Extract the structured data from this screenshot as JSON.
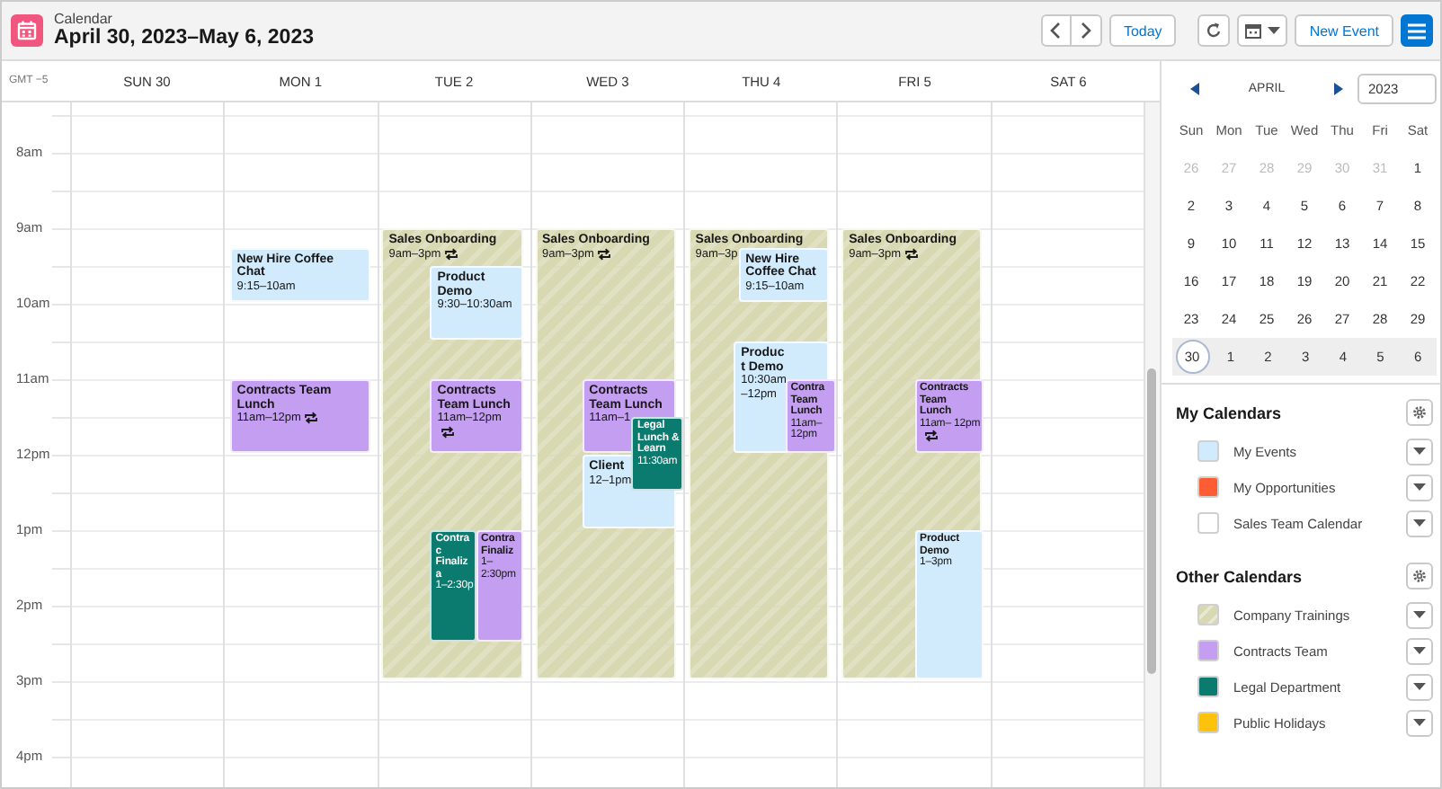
{
  "header": {
    "app_name": "Calendar",
    "title": "April 30, 2023–May 6, 2023",
    "buttons": {
      "today": "Today",
      "new_event": "New Event"
    },
    "list_view_selected": true
  },
  "week_view": {
    "timezone": "GMT −5",
    "hours": [
      "8am",
      "9am",
      "10am",
      "11am",
      "12pm",
      "1pm",
      "2pm",
      "3pm",
      "4pm"
    ],
    "days": [
      {
        "label": "SUN 30"
      },
      {
        "label": "MON 1",
        "events": [
          {
            "title": "New Hire Coffee Chat",
            "time": "9:15–10am",
            "color": "#d2ebfc",
            "kind": "solid",
            "recurring": false
          },
          {
            "title": "Contracts Team Lunch",
            "time": "11am–12pm",
            "color": "#c49ef0",
            "kind": "solid",
            "recurring": true
          }
        ]
      },
      {
        "label": "TUE 2",
        "events": [
          {
            "title": "Sales Onboarding",
            "time": "9am–3pm",
            "color": "#d8d9b3",
            "kind": "striped",
            "recurring": true
          },
          {
            "title": "Product Demo",
            "time": "9:30–10:30am",
            "color": "#d2ebfc",
            "kind": "solid",
            "recurring": false
          },
          {
            "title": "Contracts Team Lunch",
            "time": "11am–12pm",
            "color": "#c49ef0",
            "kind": "solid",
            "recurring": true
          },
          {
            "title": "Contrac Finaliza",
            "time": "1–2:30p",
            "color": "#0b7b70",
            "kind": "solid",
            "recurring": false
          },
          {
            "title": "Contra Finaliz",
            "time": "1– 2:30pm",
            "color": "#c49ef0",
            "kind": "solid",
            "recurring": false
          }
        ]
      },
      {
        "label": "WED 3",
        "events": [
          {
            "title": "Sales Onboarding",
            "time": "9am–3pm",
            "color": "#d8d9b3",
            "kind": "striped",
            "recurring": true
          },
          {
            "title": "Contracts Team Lunch",
            "time": "11am–1",
            "color": "#c49ef0",
            "kind": "solid",
            "recurring": false
          },
          {
            "title": "Client",
            "time": "12–1pm",
            "color": "#d2ebfc",
            "kind": "solid",
            "recurring": false
          },
          {
            "title": "Legal Lunch & Learn",
            "time": "11:30am",
            "color": "#0b7b70",
            "kind": "solid",
            "recurring": false
          }
        ]
      },
      {
        "label": "THU 4",
        "events": [
          {
            "title": "Sales Onboarding",
            "time": "9am–3p",
            "color": "#d8d9b3",
            "kind": "striped",
            "recurring": false
          },
          {
            "title": "New Hire Coffee Chat",
            "time": "9:15–10am",
            "color": "#d2ebfc",
            "kind": "solid",
            "recurring": false
          },
          {
            "title": "Product Demo",
            "time": "10:30am–12pm",
            "color": "#d2ebfc",
            "kind": "solid",
            "recurring": false
          },
          {
            "title": "Contra Team Lunch",
            "time": "11am– 12pm",
            "color": "#c49ef0",
            "kind": "solid",
            "recurring": false
          }
        ]
      },
      {
        "label": "FRI 5",
        "events": [
          {
            "title": "Sales Onboarding",
            "time": "9am–3pm",
            "color": "#d8d9b3",
            "kind": "striped",
            "recurring": true
          },
          {
            "title": "Contracts Team Lunch",
            "time": "11am– 12pm",
            "color": "#c49ef0",
            "kind": "solid",
            "recurring": true
          },
          {
            "title": "Product Demo",
            "time": "1–3pm",
            "color": "#d2ebfc",
            "kind": "solid",
            "recurring": false
          }
        ]
      },
      {
        "label": "SAT 6"
      }
    ]
  },
  "mini_calendar": {
    "month": "APRIL",
    "year": "2023",
    "weekdays": [
      "Sun",
      "Mon",
      "Tue",
      "Wed",
      "Thu",
      "Fri",
      "Sat"
    ],
    "weeks": [
      {
        "days": [
          {
            "label": "26",
            "muted": true,
            "selected": false
          },
          {
            "label": "27",
            "muted": true,
            "selected": false
          },
          {
            "label": "28",
            "muted": true,
            "selected": false
          },
          {
            "label": "29",
            "muted": true,
            "selected": false
          },
          {
            "label": "30",
            "muted": true,
            "selected": false
          },
          {
            "label": "31",
            "muted": true,
            "selected": false
          },
          {
            "label": "1",
            "muted": false,
            "selected": false
          }
        ]
      },
      {
        "days": [
          {
            "label": "2",
            "muted": false,
            "selected": false
          },
          {
            "label": "3",
            "muted": false,
            "selected": false
          },
          {
            "label": "4",
            "muted": false,
            "selected": false
          },
          {
            "label": "5",
            "muted": false,
            "selected": false
          },
          {
            "label": "6",
            "muted": false,
            "selected": false
          },
          {
            "label": "7",
            "muted": false,
            "selected": false
          },
          {
            "label": "8",
            "muted": false,
            "selected": false
          }
        ]
      },
      {
        "days": [
          {
            "label": "9",
            "muted": false,
            "selected": false
          },
          {
            "label": "10",
            "muted": false,
            "selected": false
          },
          {
            "label": "11",
            "muted": false,
            "selected": false
          },
          {
            "label": "12",
            "muted": false,
            "selected": false
          },
          {
            "label": "13",
            "muted": false,
            "selected": false
          },
          {
            "label": "14",
            "muted": false,
            "selected": false
          },
          {
            "label": "15",
            "muted": false,
            "selected": false
          }
        ]
      },
      {
        "days": [
          {
            "label": "16",
            "muted": false,
            "selected": false
          },
          {
            "label": "17",
            "muted": false,
            "selected": false
          },
          {
            "label": "18",
            "muted": false,
            "selected": false
          },
          {
            "label": "19",
            "muted": false,
            "selected": false
          },
          {
            "label": "20",
            "muted": false,
            "selected": false
          },
          {
            "label": "21",
            "muted": false,
            "selected": false
          },
          {
            "label": "22",
            "muted": false,
            "selected": false
          }
        ]
      },
      {
        "days": [
          {
            "label": "23",
            "muted": false,
            "selected": false
          },
          {
            "label": "24",
            "muted": false,
            "selected": false
          },
          {
            "label": "25",
            "muted": false,
            "selected": false
          },
          {
            "label": "26",
            "muted": false,
            "selected": false
          },
          {
            "label": "27",
            "muted": false,
            "selected": false
          },
          {
            "label": "28",
            "muted": false,
            "selected": false
          },
          {
            "label": "29",
            "muted": false,
            "selected": false
          }
        ]
      },
      {
        "days": [
          {
            "label": "30",
            "muted": false,
            "selected": true
          },
          {
            "label": "1",
            "muted": false,
            "selected": false
          },
          {
            "label": "2",
            "muted": false,
            "selected": false
          },
          {
            "label": "3",
            "muted": false,
            "selected": false
          },
          {
            "label": "4",
            "muted": false,
            "selected": false
          },
          {
            "label": "5",
            "muted": false,
            "selected": false
          },
          {
            "label": "6",
            "muted": false,
            "selected": false
          }
        ]
      }
    ]
  },
  "calendar_groups": [
    {
      "title": "My Calendars",
      "items": [
        {
          "label": "My Events",
          "color": "#d2ebfc",
          "kind": "solid"
        },
        {
          "label": "My Opportunities",
          "color": "#fe5c32",
          "kind": "solid"
        },
        {
          "label": "Sales Team Calendar",
          "color": "#ffffff",
          "kind": "solid"
        }
      ]
    },
    {
      "title": "Other Calendars",
      "items": [
        {
          "label": "Company Trainings",
          "color": "#d8d9b3",
          "kind": "striped"
        },
        {
          "label": "Contracts Team",
          "color": "#c49ef0",
          "kind": "solid"
        },
        {
          "label": "Legal Department",
          "color": "#0b7b70",
          "kind": "solid"
        },
        {
          "label": "Public Holidays",
          "color": "#fdc20b",
          "kind": "solid"
        }
      ]
    }
  ]
}
